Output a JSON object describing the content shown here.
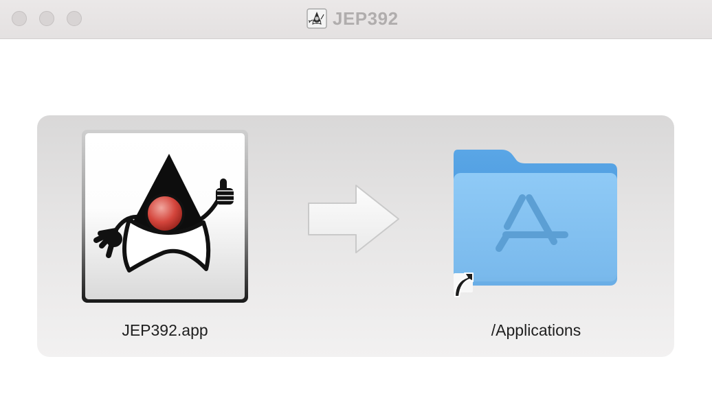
{
  "window": {
    "title": "JEP392"
  },
  "installer": {
    "app_label": "JEP392.app",
    "destination_label": "/Applications"
  },
  "icons": {
    "title_icon": "duke-mascot-icon",
    "app_icon": "duke-mascot-icon",
    "arrow": "right-arrow-icon",
    "destination_icon": "applications-folder-icon",
    "alias_badge": "alias-arrow-icon"
  },
  "colors": {
    "folder_front": "#84c3f2",
    "folder_back": "#4f9ee0",
    "duke_nose": "#d4453c",
    "titlebar": "#e8e5e5"
  }
}
